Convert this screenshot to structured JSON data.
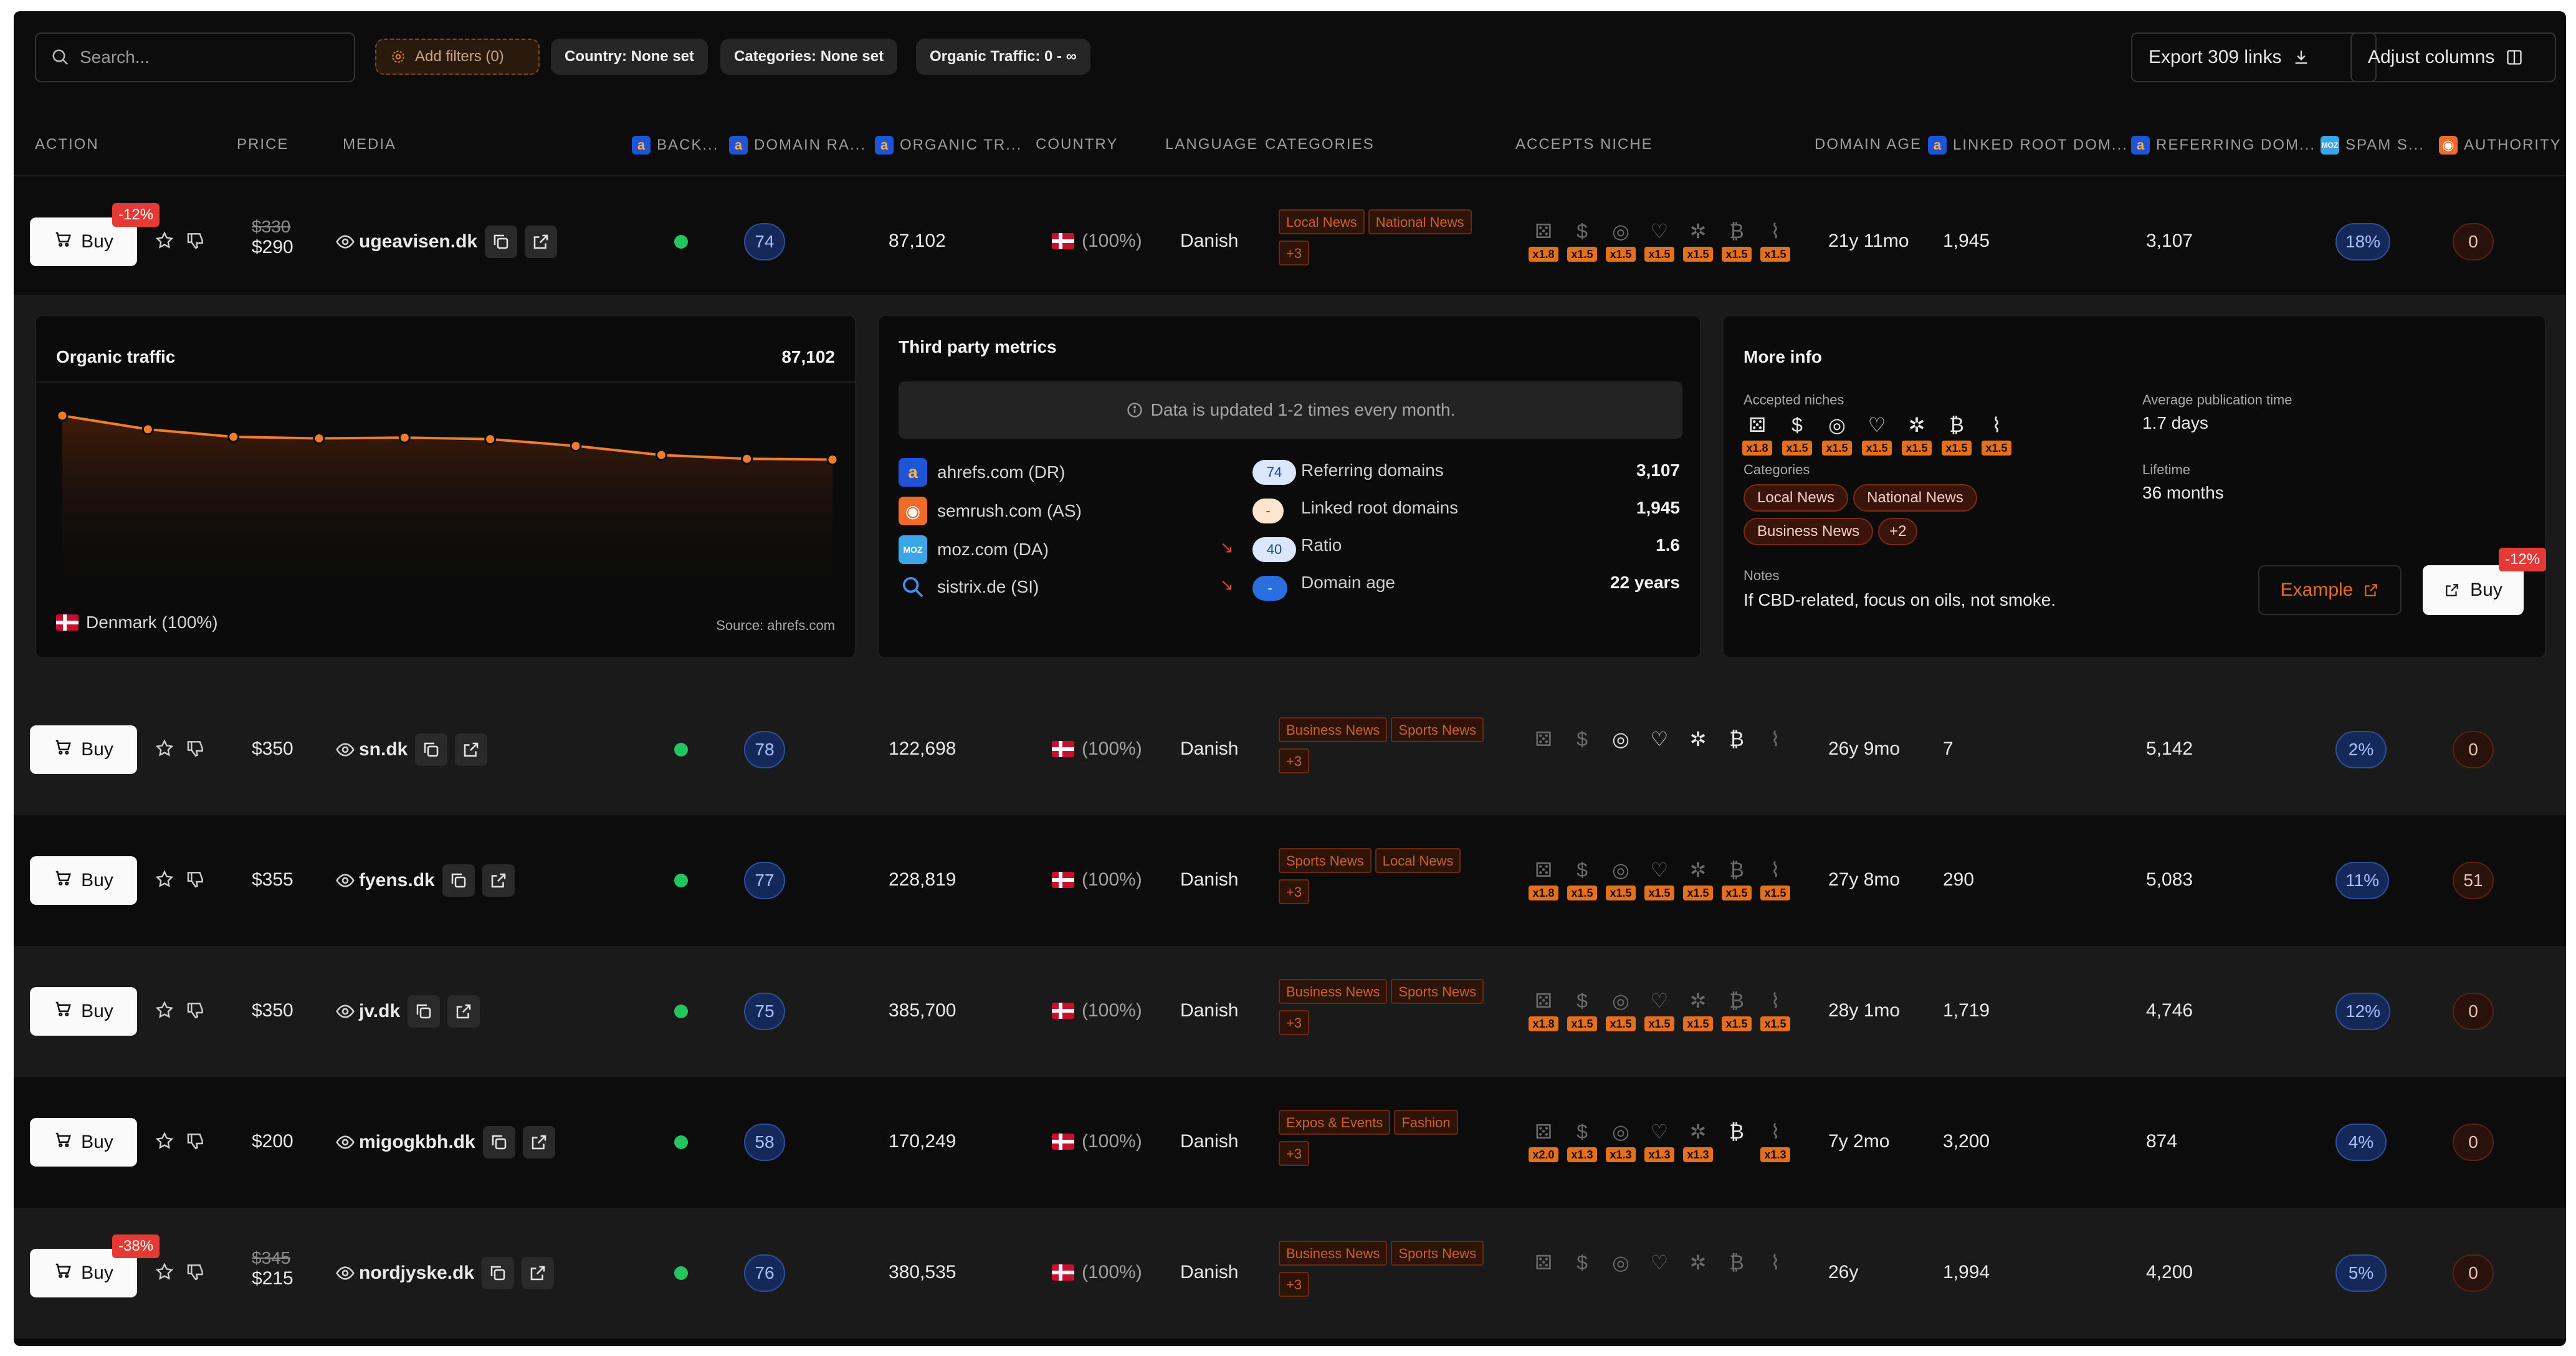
{
  "toolbar": {
    "search_placeholder": "Search...",
    "add_filters": "Add filters (0)",
    "country_filter": "Country: None set",
    "categories_filter": "Categories: None set",
    "traffic_filter": "Organic Traffic: 0 - ∞",
    "export": "Export 309 links",
    "adjust": "Adjust columns"
  },
  "columns": {
    "action": "ACTION",
    "price": "PRICE",
    "media": "MEDIA",
    "back": "BACK...",
    "domain_rating": "DOMAIN RA...",
    "organic_traffic": "ORGANIC TR...",
    "country": "COUNTRY",
    "language": "LANGUAGE",
    "categories": "CATEGORIES",
    "accepts_niche": "ACCEPTS NICHE",
    "domain_age": "DOMAIN AGE",
    "linked_root": "LINKED ROOT DOM...",
    "referring": "REFERRING DOM...",
    "spam": "SPAM S...",
    "authority": "AUTHORITY"
  },
  "buy_label": "Buy",
  "rows": [
    {
      "discount": "-12%",
      "old_price": "$330",
      "price": "$290",
      "media": "ugeavisen.dk",
      "dr": "74",
      "traffic": "87,102",
      "country": "(100%)",
      "language": "Danish",
      "tags": [
        "Local News",
        "National News",
        "+3"
      ],
      "niche_on": [
        false,
        false,
        false,
        false,
        false,
        false,
        false
      ],
      "mults": [
        "x1.8",
        "x1.5",
        "x1.5",
        "x1.5",
        "x1.5",
        "x1.5",
        "x1.5"
      ],
      "age": "21y 11mo",
      "linked": "1,945",
      "referring": "3,107",
      "spam": "18%",
      "authority": "0"
    },
    {
      "discount": "",
      "old_price": "",
      "price": "$350",
      "media": "sn.dk",
      "dr": "78",
      "traffic": "122,698",
      "country": "(100%)",
      "language": "Danish",
      "tags": [
        "Business News",
        "Sports News",
        "+3"
      ],
      "niche_on": [
        false,
        false,
        true,
        true,
        true,
        true,
        false
      ],
      "mults": [
        "",
        "",
        "",
        "",
        "",
        "",
        ""
      ],
      "age": "26y 9mo",
      "linked": "7",
      "referring": "5,142",
      "spam": "2%",
      "authority": "0"
    },
    {
      "discount": "",
      "old_price": "",
      "price": "$355",
      "media": "fyens.dk",
      "dr": "77",
      "traffic": "228,819",
      "country": "(100%)",
      "language": "Danish",
      "tags": [
        "Sports News",
        "Local News",
        "+3"
      ],
      "niche_on": [
        false,
        false,
        false,
        false,
        false,
        false,
        false
      ],
      "mults": [
        "x1.8",
        "x1.5",
        "x1.5",
        "x1.5",
        "x1.5",
        "x1.5",
        "x1.5"
      ],
      "age": "27y 8mo",
      "linked": "290",
      "referring": "5,083",
      "spam": "11%",
      "authority": "51"
    },
    {
      "discount": "",
      "old_price": "",
      "price": "$350",
      "media": "jv.dk",
      "dr": "75",
      "traffic": "385,700",
      "country": "(100%)",
      "language": "Danish",
      "tags": [
        "Business News",
        "Sports News",
        "+3"
      ],
      "niche_on": [
        false,
        false,
        false,
        false,
        false,
        false,
        false
      ],
      "mults": [
        "x1.8",
        "x1.5",
        "x1.5",
        "x1.5",
        "x1.5",
        "x1.5",
        "x1.5"
      ],
      "age": "28y 1mo",
      "linked": "1,719",
      "referring": "4,746",
      "spam": "12%",
      "authority": "0"
    },
    {
      "discount": "",
      "old_price": "",
      "price": "$200",
      "media": "migogkbh.dk",
      "dr": "58",
      "traffic": "170,249",
      "country": "(100%)",
      "language": "Danish",
      "tags": [
        "Expos & Events",
        "Fashion",
        "+3"
      ],
      "niche_on": [
        false,
        false,
        false,
        false,
        false,
        true,
        false
      ],
      "mults": [
        "x2.0",
        "x1.3",
        "x1.3",
        "x1.3",
        "x1.3",
        "",
        "x1.3"
      ],
      "age": "7y 2mo",
      "linked": "3,200",
      "referring": "874",
      "spam": "4%",
      "authority": "0"
    },
    {
      "discount": "-38%",
      "old_price": "$345",
      "price": "$215",
      "media": "nordjyske.dk",
      "dr": "76",
      "traffic": "380,535",
      "country": "(100%)",
      "language": "Danish",
      "tags": [
        "Business News",
        "Sports News",
        "+3"
      ],
      "niche_on": [
        false,
        false,
        false,
        false,
        false,
        false,
        false
      ],
      "mults": [
        "",
        "",
        "",
        "",
        "",
        "",
        ""
      ],
      "age": "26y",
      "linked": "1,994",
      "referring": "4,200",
      "spam": "5%",
      "authority": "0"
    }
  ],
  "niche_icons": [
    "dice-icon",
    "dollar-icon",
    "cbd-icon",
    "heart-icon",
    "cannabis-icon",
    "bitcoin-icon",
    "trading-icon"
  ],
  "organic": {
    "title": "Organic traffic",
    "value": "87,102",
    "country": "Denmark (100%)",
    "source": "Source: ahrefs.com"
  },
  "chart_data": {
    "type": "area",
    "title": "Organic traffic",
    "values": [
      100,
      91,
      86,
      85,
      85.5,
      84.5,
      80,
      74,
      71.5,
      71
    ],
    "xlabel": "",
    "ylabel": ""
  },
  "third_party": {
    "title": "Third party metrics",
    "info": "Data is updated 1-2 times every month.",
    "metrics": [
      {
        "label": "ahrefs.com (DR)",
        "value": "74"
      },
      {
        "label": "semrush.com (AS)",
        "value": "-"
      },
      {
        "label": "moz.com (DA)",
        "value": "40"
      },
      {
        "label": "sistrix.de (SI)",
        "value": "-"
      }
    ],
    "stats": [
      {
        "label": "Referring domains",
        "value": "3,107"
      },
      {
        "label": "Linked root domains",
        "value": "1,945"
      },
      {
        "label": "Ratio",
        "value": "1.6"
      },
      {
        "label": "Domain age",
        "value": "22 years"
      }
    ]
  },
  "more_info": {
    "title": "More info",
    "accepted_niches_label": "Accepted niches",
    "niche_mults": [
      "x1.8",
      "x1.5",
      "x1.5",
      "x1.5",
      "x1.5",
      "x1.5",
      "x1.5"
    ],
    "categories_label": "Categories",
    "categories": [
      "Local News",
      "National News",
      "Business News",
      "+2"
    ],
    "avg_pub_label": "Average publication time",
    "avg_pub_value": "1.7 days",
    "lifetime_label": "Lifetime",
    "lifetime_value": "36 months",
    "notes_label": "Notes",
    "notes_value": "If CBD-related, focus on oils, not smoke.",
    "example_label": "Example",
    "buy_label": "Buy",
    "discount": "-12%"
  }
}
